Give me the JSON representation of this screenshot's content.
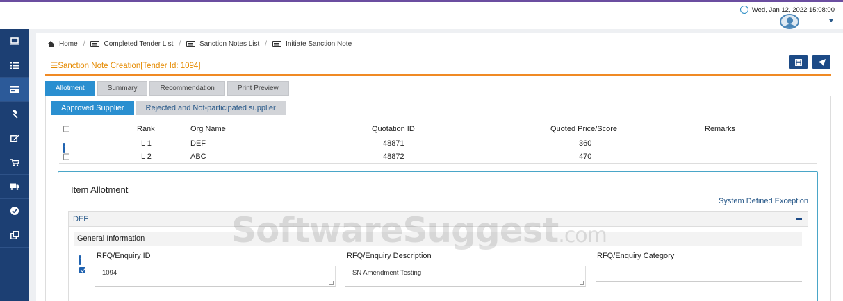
{
  "header": {
    "datetime": "Wed, Jan 12, 2022 15:08:00"
  },
  "sidebar": {
    "items": [
      {
        "icon": "laptop-icon"
      },
      {
        "icon": "list-icon"
      },
      {
        "icon": "card-icon"
      },
      {
        "icon": "gavel-icon"
      },
      {
        "icon": "edit-icon"
      },
      {
        "icon": "cart-icon"
      },
      {
        "icon": "truck-icon"
      },
      {
        "icon": "check-circle-icon"
      },
      {
        "icon": "copy-icon"
      }
    ]
  },
  "breadcrumb": {
    "home": "Home",
    "completed": "Completed Tender List",
    "sanction": "Sanction Notes List",
    "initiate": "Initiate Sanction Note"
  },
  "page": {
    "title": "Sanction Note Creation[Tender Id: 1094]"
  },
  "tabs": [
    "Allotment",
    "Summary",
    "Recommendation",
    "Print Preview"
  ],
  "subtabs": [
    "Approved Supplier",
    "Rejected and Not-participated supplier"
  ],
  "suppliers": {
    "headers": {
      "rank": "Rank",
      "org": "Org Name",
      "quotation": "Quotation ID",
      "price": "Quoted Price/Score",
      "remarks": "Remarks"
    },
    "rows": [
      {
        "checked": true,
        "rank": "L 1",
        "org": "DEF",
        "quotation": "48871",
        "price": "360"
      },
      {
        "checked": false,
        "rank": "L 2",
        "org": "ABC",
        "quotation": "48872",
        "price": "470"
      }
    ]
  },
  "allotment": {
    "title": "Item Allotment",
    "exception_link": "System Defined Exception",
    "supplier": "DEF",
    "general_info": "General Information",
    "headers": {
      "id": "RFQ/Enquiry ID",
      "desc": "RFQ/Enquiry Description",
      "category": "RFQ/Enquiry Category"
    },
    "row": {
      "id": "1094",
      "desc": "SN Amendment Testing",
      "category": ""
    }
  },
  "watermark": {
    "main": "SoftwareSuggest",
    "suffix": ".com"
  },
  "colors": {
    "accent": "#2a8fd0",
    "sidebar": "#1c3f73",
    "title": "#e58a00",
    "underline": "#f08a24"
  }
}
